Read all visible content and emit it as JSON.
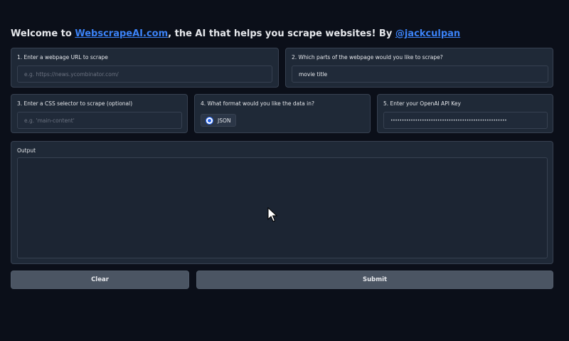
{
  "header": {
    "prefix": "Welcome to ",
    "site_link": "WebscrapeAI.com",
    "middle": ", the AI that helps you scrape websites! By ",
    "author_link": "@jackculpan"
  },
  "url_panel": {
    "label": "1. Enter a webpage URL to scrape",
    "placeholder": "e.g. https://news.ycombinator.com/",
    "value": ""
  },
  "parts_panel": {
    "label": "2. Which parts of the webpage would you like to scrape?",
    "value": "movie title"
  },
  "css_panel": {
    "label": "3. Enter a CSS selector to scrape (optional)",
    "placeholder": "e.g. 'main-content'",
    "value": ""
  },
  "format_panel": {
    "label": "4. What format would you like the data in?",
    "options": [
      "JSON"
    ],
    "selected": "JSON"
  },
  "api_panel": {
    "label": "5. Enter your OpenAI API Key",
    "masked_value": "••••••••••••••••••••••••••••••••••••••••••••••••••••"
  },
  "output_panel": {
    "label": "Output",
    "value": ""
  },
  "buttons": {
    "clear": "Clear",
    "submit": "Submit"
  },
  "colors": {
    "background": "#0b0f19",
    "panel": "#1f2937",
    "link": "#3b82f6",
    "button": "#4b5563",
    "radio_accent": "#2563eb"
  }
}
